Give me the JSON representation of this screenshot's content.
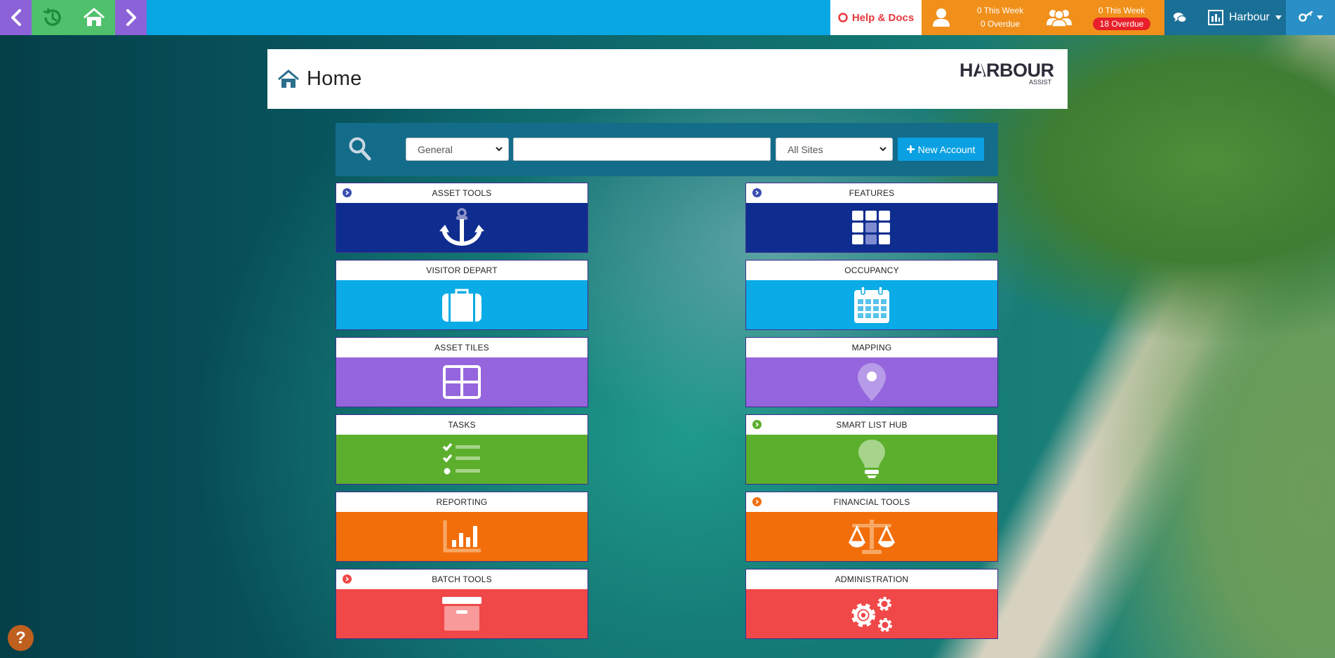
{
  "topbar": {
    "help_label": "Help & Docs",
    "my_stats": {
      "this_week": "0 This Week",
      "overdue": "0 Overdue"
    },
    "team_stats": {
      "this_week": "0 This Week",
      "overdue": "18 Overdue"
    },
    "site_label": "Harbour"
  },
  "header": {
    "title": "Home",
    "logo_text": "HARBOUR",
    "logo_sub": "ASSIST"
  },
  "search": {
    "category_value": "General",
    "input_value": "",
    "sites_value": "All Sites",
    "new_account_label": "New Account"
  },
  "tiles": [
    {
      "label": "ASSET TOOLS",
      "icon": "anchor-icon",
      "color": "#0f2d8f"
    },
    {
      "label": "FEATURES",
      "icon": "grid-icon",
      "color": "#0f2d8f"
    },
    {
      "label": "VISITOR DEPART",
      "icon": "suitcase-icon",
      "color": "#0aabe6"
    },
    {
      "label": "OCCUPANCY",
      "icon": "calendar-icon",
      "color": "#0aabe6"
    },
    {
      "label": "ASSET TILES",
      "icon": "tiles-icon",
      "color": "#9565dd"
    },
    {
      "label": "MAPPING",
      "icon": "map-pin-icon",
      "color": "#9565dd"
    },
    {
      "label": "TASKS",
      "icon": "checklist-icon",
      "color": "#5caf2c"
    },
    {
      "label": "SMART LIST HUB",
      "icon": "lightbulb-icon",
      "color": "#5caf2c"
    },
    {
      "label": "REPORTING",
      "icon": "bar-chart-icon",
      "color": "#f26e0a"
    },
    {
      "label": "FINANCIAL TOOLS",
      "icon": "scales-icon",
      "color": "#f26e0a"
    },
    {
      "label": "BATCH TOOLS",
      "icon": "archive-icon",
      "color": "#f04848"
    },
    {
      "label": "ADMINISTRATION",
      "icon": "gears-icon",
      "color": "#f04848"
    }
  ],
  "help_float": "?"
}
